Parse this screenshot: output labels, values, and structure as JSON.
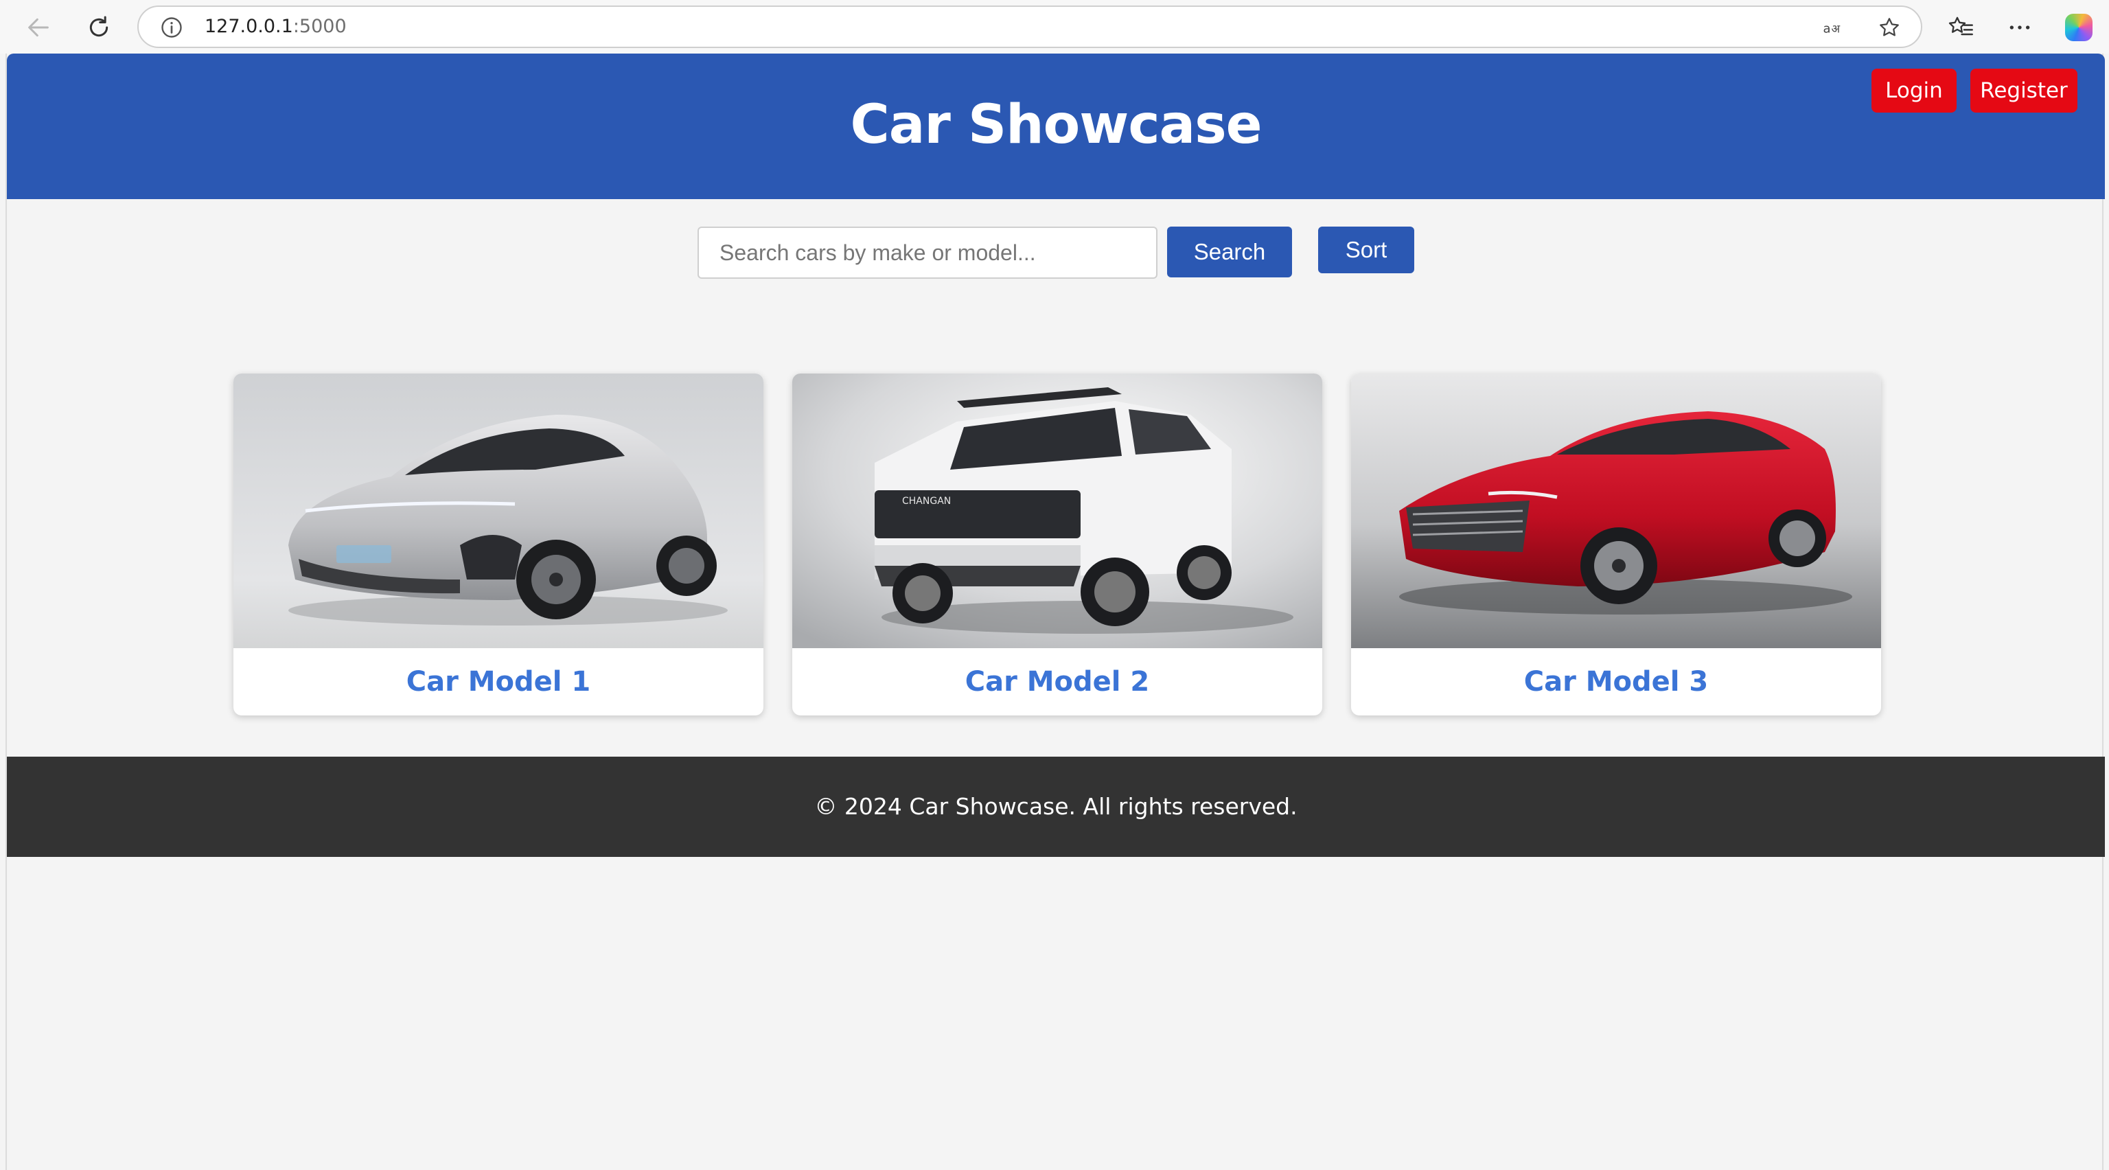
{
  "browser": {
    "url_host": "127.0.0.1",
    "url_port": ":5000",
    "icons": [
      "back-arrow-icon",
      "reload-icon",
      "site-info-icon",
      "read-aloud-icon",
      "favorite-star-icon",
      "favorites-icon",
      "more-icon",
      "copilot-icon"
    ]
  },
  "header": {
    "title": "Car Showcase",
    "login_label": "Login",
    "register_label": "Register",
    "color": "#2b58b3",
    "auth_button_color": "#e50914"
  },
  "search": {
    "placeholder": "Search cars by make or model...",
    "value": "",
    "search_label": "Search",
    "sort_label": "Sort"
  },
  "cars": [
    {
      "title": "Car Model 1",
      "image": "silver electric coupe-SUV",
      "color": "#c9c9c9"
    },
    {
      "title": "Car Model 2",
      "image": "white SUV",
      "color": "#f2f2f2"
    },
    {
      "title": "Car Model 3",
      "image": "red sedan",
      "color": "#c8102e"
    }
  ],
  "footer": {
    "text": "© 2024 Car Showcase. All rights reserved."
  }
}
